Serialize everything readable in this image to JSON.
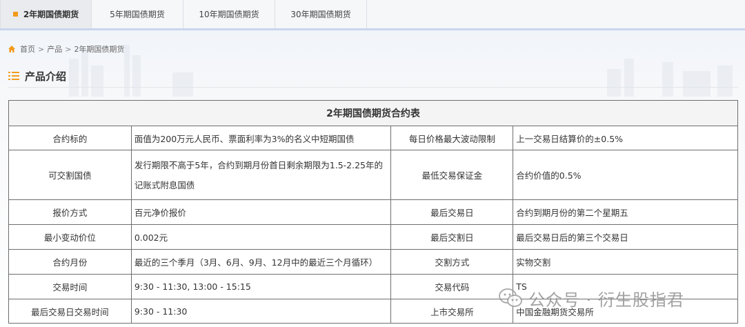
{
  "tabs": [
    {
      "label": "2年期国债期货",
      "active": true
    },
    {
      "label": "5年期国债期货",
      "active": false
    },
    {
      "label": "10年期国债期货",
      "active": false
    },
    {
      "label": "30年期国债期货",
      "active": false
    }
  ],
  "breadcrumb": {
    "home": "首页",
    "sep": ">",
    "level1": "产品",
    "current": "2年期国债期货"
  },
  "section": {
    "title": "产品介绍"
  },
  "table": {
    "title": "2年期国债期货合约表",
    "rows": [
      {
        "label1": "合约标的",
        "value1": "面值为200万元人民币、票面利率为3%的名义中短期国债",
        "label2": "每日价格最大波动限制",
        "value2": "上一交易日结算价的±0.5%"
      },
      {
        "label1": "可交割国债",
        "value1": "发行期限不高于5年，合约到期月份首日剩余期限为1.5-2.25年的记账式附息国债",
        "label2": "最低交易保证金",
        "value2": "合约价值的0.5%"
      },
      {
        "label1": "报价方式",
        "value1": "百元净价报价",
        "label2": "最后交易日",
        "value2": "合约到期月份的第二个星期五"
      },
      {
        "label1": "最小变动价位",
        "value1": "0.002元",
        "label2": "最后交割日",
        "value2": "最后交易日后的第三个交易日"
      },
      {
        "label1": "合约月份",
        "value1": "最近的三个季月（3月、6月、9月、12月中的最近三个月循环）",
        "label2": "交割方式",
        "value2": "实物交割"
      },
      {
        "label1": "交易时间",
        "value1": "9:30 - 11:30, 13:00 - 15:15",
        "label2": "交易代码",
        "value2": "TS"
      },
      {
        "label1": "最后交易日交易时间",
        "value1": "9:30 - 11:30",
        "label2": "上市交易所",
        "value2": "中国金融期货交易所"
      }
    ]
  },
  "watermark": {
    "text": "公众号 · 衍生股指君"
  },
  "colors": {
    "accent": "#f29b1b",
    "tab_border": "#c9d6ec",
    "table_border": "#6d6d6d"
  }
}
